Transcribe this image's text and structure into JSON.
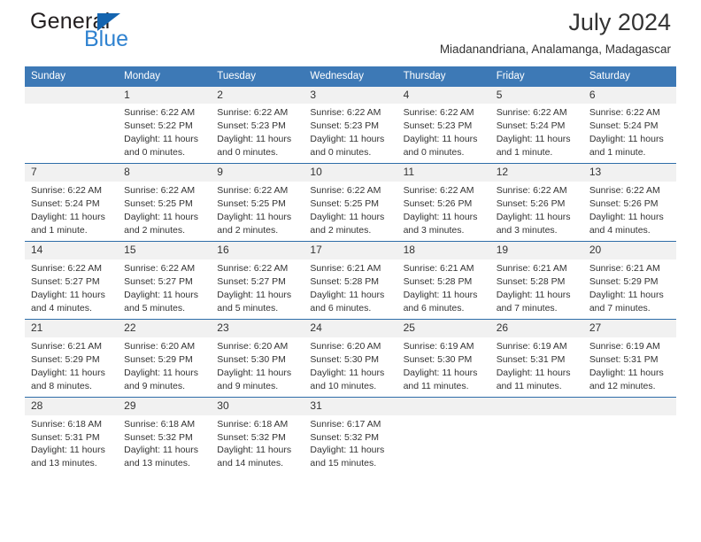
{
  "brand": {
    "name_dark": "General",
    "name_blue": "Blue",
    "triangle_color": "#1565b0",
    "blue_color": "#2f82d0"
  },
  "header": {
    "title": "July 2024",
    "subtitle": "Miadanandriana, Analamanga, Madagascar"
  },
  "theme": {
    "header_blue": "#3d79b6",
    "separator_blue": "#2e6da8",
    "daynum_band": "#f1f1f1"
  },
  "weekday_headers": [
    "Sunday",
    "Monday",
    "Tuesday",
    "Wednesday",
    "Thursday",
    "Friday",
    "Saturday"
  ],
  "weeks": [
    [
      {
        "day": "",
        "sunrise": "",
        "sunset": "",
        "daylight1": "",
        "daylight2": ""
      },
      {
        "day": "1",
        "sunrise": "Sunrise: 6:22 AM",
        "sunset": "Sunset: 5:22 PM",
        "daylight1": "Daylight: 11 hours",
        "daylight2": "and 0 minutes."
      },
      {
        "day": "2",
        "sunrise": "Sunrise: 6:22 AM",
        "sunset": "Sunset: 5:23 PM",
        "daylight1": "Daylight: 11 hours",
        "daylight2": "and 0 minutes."
      },
      {
        "day": "3",
        "sunrise": "Sunrise: 6:22 AM",
        "sunset": "Sunset: 5:23 PM",
        "daylight1": "Daylight: 11 hours",
        "daylight2": "and 0 minutes."
      },
      {
        "day": "4",
        "sunrise": "Sunrise: 6:22 AM",
        "sunset": "Sunset: 5:23 PM",
        "daylight1": "Daylight: 11 hours",
        "daylight2": "and 0 minutes."
      },
      {
        "day": "5",
        "sunrise": "Sunrise: 6:22 AM",
        "sunset": "Sunset: 5:24 PM",
        "daylight1": "Daylight: 11 hours",
        "daylight2": "and 1 minute."
      },
      {
        "day": "6",
        "sunrise": "Sunrise: 6:22 AM",
        "sunset": "Sunset: 5:24 PM",
        "daylight1": "Daylight: 11 hours",
        "daylight2": "and 1 minute."
      }
    ],
    [
      {
        "day": "7",
        "sunrise": "Sunrise: 6:22 AM",
        "sunset": "Sunset: 5:24 PM",
        "daylight1": "Daylight: 11 hours",
        "daylight2": "and 1 minute."
      },
      {
        "day": "8",
        "sunrise": "Sunrise: 6:22 AM",
        "sunset": "Sunset: 5:25 PM",
        "daylight1": "Daylight: 11 hours",
        "daylight2": "and 2 minutes."
      },
      {
        "day": "9",
        "sunrise": "Sunrise: 6:22 AM",
        "sunset": "Sunset: 5:25 PM",
        "daylight1": "Daylight: 11 hours",
        "daylight2": "and 2 minutes."
      },
      {
        "day": "10",
        "sunrise": "Sunrise: 6:22 AM",
        "sunset": "Sunset: 5:25 PM",
        "daylight1": "Daylight: 11 hours",
        "daylight2": "and 2 minutes."
      },
      {
        "day": "11",
        "sunrise": "Sunrise: 6:22 AM",
        "sunset": "Sunset: 5:26 PM",
        "daylight1": "Daylight: 11 hours",
        "daylight2": "and 3 minutes."
      },
      {
        "day": "12",
        "sunrise": "Sunrise: 6:22 AM",
        "sunset": "Sunset: 5:26 PM",
        "daylight1": "Daylight: 11 hours",
        "daylight2": "and 3 minutes."
      },
      {
        "day": "13",
        "sunrise": "Sunrise: 6:22 AM",
        "sunset": "Sunset: 5:26 PM",
        "daylight1": "Daylight: 11 hours",
        "daylight2": "and 4 minutes."
      }
    ],
    [
      {
        "day": "14",
        "sunrise": "Sunrise: 6:22 AM",
        "sunset": "Sunset: 5:27 PM",
        "daylight1": "Daylight: 11 hours",
        "daylight2": "and 4 minutes."
      },
      {
        "day": "15",
        "sunrise": "Sunrise: 6:22 AM",
        "sunset": "Sunset: 5:27 PM",
        "daylight1": "Daylight: 11 hours",
        "daylight2": "and 5 minutes."
      },
      {
        "day": "16",
        "sunrise": "Sunrise: 6:22 AM",
        "sunset": "Sunset: 5:27 PM",
        "daylight1": "Daylight: 11 hours",
        "daylight2": "and 5 minutes."
      },
      {
        "day": "17",
        "sunrise": "Sunrise: 6:21 AM",
        "sunset": "Sunset: 5:28 PM",
        "daylight1": "Daylight: 11 hours",
        "daylight2": "and 6 minutes."
      },
      {
        "day": "18",
        "sunrise": "Sunrise: 6:21 AM",
        "sunset": "Sunset: 5:28 PM",
        "daylight1": "Daylight: 11 hours",
        "daylight2": "and 6 minutes."
      },
      {
        "day": "19",
        "sunrise": "Sunrise: 6:21 AM",
        "sunset": "Sunset: 5:28 PM",
        "daylight1": "Daylight: 11 hours",
        "daylight2": "and 7 minutes."
      },
      {
        "day": "20",
        "sunrise": "Sunrise: 6:21 AM",
        "sunset": "Sunset: 5:29 PM",
        "daylight1": "Daylight: 11 hours",
        "daylight2": "and 7 minutes."
      }
    ],
    [
      {
        "day": "21",
        "sunrise": "Sunrise: 6:21 AM",
        "sunset": "Sunset: 5:29 PM",
        "daylight1": "Daylight: 11 hours",
        "daylight2": "and 8 minutes."
      },
      {
        "day": "22",
        "sunrise": "Sunrise: 6:20 AM",
        "sunset": "Sunset: 5:29 PM",
        "daylight1": "Daylight: 11 hours",
        "daylight2": "and 9 minutes."
      },
      {
        "day": "23",
        "sunrise": "Sunrise: 6:20 AM",
        "sunset": "Sunset: 5:30 PM",
        "daylight1": "Daylight: 11 hours",
        "daylight2": "and 9 minutes."
      },
      {
        "day": "24",
        "sunrise": "Sunrise: 6:20 AM",
        "sunset": "Sunset: 5:30 PM",
        "daylight1": "Daylight: 11 hours",
        "daylight2": "and 10 minutes."
      },
      {
        "day": "25",
        "sunrise": "Sunrise: 6:19 AM",
        "sunset": "Sunset: 5:30 PM",
        "daylight1": "Daylight: 11 hours",
        "daylight2": "and 11 minutes."
      },
      {
        "day": "26",
        "sunrise": "Sunrise: 6:19 AM",
        "sunset": "Sunset: 5:31 PM",
        "daylight1": "Daylight: 11 hours",
        "daylight2": "and 11 minutes."
      },
      {
        "day": "27",
        "sunrise": "Sunrise: 6:19 AM",
        "sunset": "Sunset: 5:31 PM",
        "daylight1": "Daylight: 11 hours",
        "daylight2": "and 12 minutes."
      }
    ],
    [
      {
        "day": "28",
        "sunrise": "Sunrise: 6:18 AM",
        "sunset": "Sunset: 5:31 PM",
        "daylight1": "Daylight: 11 hours",
        "daylight2": "and 13 minutes."
      },
      {
        "day": "29",
        "sunrise": "Sunrise: 6:18 AM",
        "sunset": "Sunset: 5:32 PM",
        "daylight1": "Daylight: 11 hours",
        "daylight2": "and 13 minutes."
      },
      {
        "day": "30",
        "sunrise": "Sunrise: 6:18 AM",
        "sunset": "Sunset: 5:32 PM",
        "daylight1": "Daylight: 11 hours",
        "daylight2": "and 14 minutes."
      },
      {
        "day": "31",
        "sunrise": "Sunrise: 6:17 AM",
        "sunset": "Sunset: 5:32 PM",
        "daylight1": "Daylight: 11 hours",
        "daylight2": "and 15 minutes."
      },
      {
        "day": "",
        "sunrise": "",
        "sunset": "",
        "daylight1": "",
        "daylight2": ""
      },
      {
        "day": "",
        "sunrise": "",
        "sunset": "",
        "daylight1": "",
        "daylight2": ""
      },
      {
        "day": "",
        "sunrise": "",
        "sunset": "",
        "daylight1": "",
        "daylight2": ""
      }
    ]
  ]
}
